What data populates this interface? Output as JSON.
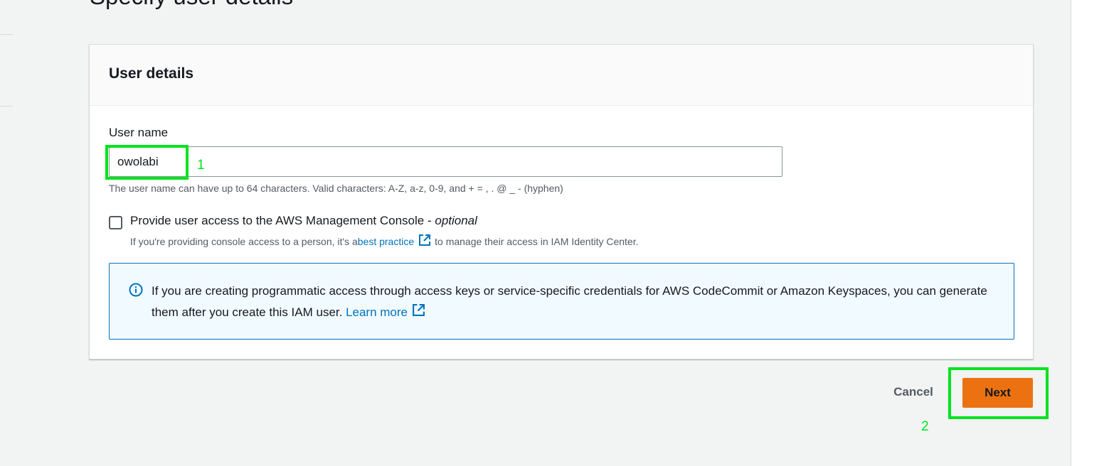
{
  "page": {
    "title": "Specify user details"
  },
  "panel": {
    "title": "User details",
    "username_label": "User name",
    "username_value": "owolabi",
    "username_help": "The user name can have up to 64 characters. Valid characters: A-Z, a-z, 0-9, and + = , . @ _ - (hyphen)",
    "console_access_label": "Provide user access to the AWS Management Console - ",
    "console_access_optional": "optional",
    "console_access_checked": false,
    "console_desc_before": "If you're providing console access to a person, it's a ",
    "console_desc_link": "best practice",
    "console_desc_after": " to manage their access in IAM Identity Center.",
    "info_text": "If you are creating programmatic access through access keys or service-specific credentials for AWS CodeCommit or Amazon Keyspaces, you can generate them after you create this IAM user. ",
    "info_link": "Learn more"
  },
  "actions": {
    "cancel_label": "Cancel",
    "next_label": "Next"
  },
  "annotations": {
    "marker_1": "1",
    "marker_2": "2",
    "highlight_color": "#00e31f"
  },
  "colors": {
    "primary_button": "#ec7211",
    "link": "#0073bb",
    "info_border": "#0073bb",
    "info_background": "#f1faff"
  },
  "icons": {
    "info": "info-circle-icon",
    "external_link": "external-link-icon"
  }
}
